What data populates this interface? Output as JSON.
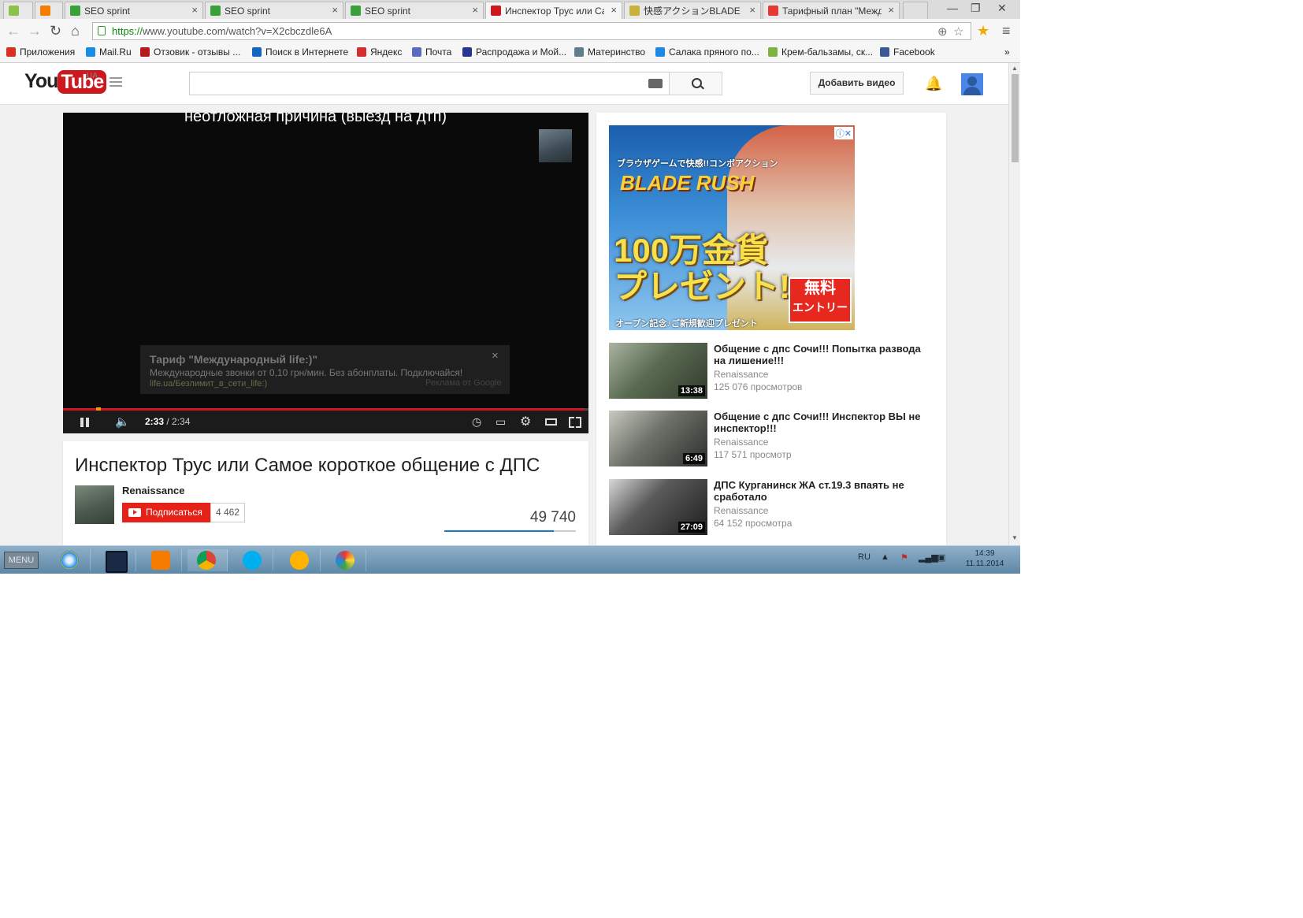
{
  "browser": {
    "tabs": [
      {
        "label": "",
        "fav": "#8bc34a"
      },
      {
        "label": "",
        "fav": "#f57d00"
      },
      {
        "label": "SEO sprint",
        "fav": "#3aa13a"
      },
      {
        "label": "SEO sprint",
        "fav": "#3aa13a"
      },
      {
        "label": "SEO sprint",
        "fav": "#3aa13a"
      },
      {
        "label": "Инспектор Трус или Сам",
        "fav": "#cc181e"
      },
      {
        "label": "快感アクションBLADE RU",
        "fav": "#c9b23c"
      },
      {
        "label": "Тарифный план \"Междун",
        "fav": "#e53935"
      }
    ],
    "close_glyph": "×",
    "window": {
      "minimize": "—",
      "restore": "❐",
      "close": "✕"
    },
    "url_scheme": "https://",
    "url_rest": "www.youtube.com/watch?v=X2cbczdle6A",
    "bookmarks": [
      {
        "label": "Приложения",
        "icon": "#d93025"
      },
      {
        "label": "Mail.Ru",
        "icon": "#168de2"
      },
      {
        "label": "Отзовик - отзывы ...",
        "icon": "#b71c1c"
      },
      {
        "label": "Поиск в Интернете",
        "icon": "#1565c0"
      },
      {
        "label": "Яндекс",
        "icon": "#d32f2f"
      },
      {
        "label": "Почта",
        "icon": "#5c6bc0"
      },
      {
        "label": "Распродажа и Мой...",
        "icon": "#283593"
      },
      {
        "label": "Материнство",
        "icon": "#607d8b"
      },
      {
        "label": "Салака пряного по...",
        "icon": "#1e88e5"
      },
      {
        "label": "Крем-бальзамы, ск...",
        "icon": "#7cb342"
      },
      {
        "label": "Facebook",
        "icon": "#3b5998"
      }
    ],
    "bookmarks_more": "»"
  },
  "youtube": {
    "logo_you": "You",
    "logo_tube": "Tube",
    "region": "UA",
    "upload_label": "Добавить видео",
    "player": {
      "subtitle": "неотложная причина (выезд на дтп)",
      "ad_title": "Тариф \"Международный life:)\"",
      "ad_desc": "Международные звонки от 0,10 грн/мин. Без абонплаты. Подключайся!",
      "ad_url": "life.ua/Безлимит_в_сети_life:)",
      "ad_by": "Реклама от Google",
      "ad_close": "×",
      "time_current": "2:33",
      "time_total": " / 2:34",
      "played_fraction": 0.993
    },
    "video": {
      "title": "Инспектор Трус или Самое короткое общение с ДПС",
      "channel": "Renaissance",
      "subscribe_label": "Подписаться",
      "subscriber_count": "4 462",
      "views": "49 740",
      "like_ratio": 0.83
    },
    "sidebar_ad": {
      "tagline": "ブラウザゲームで快感!!コンボアクション",
      "brand": "BLADE RUSH",
      "headline_1": "100万金貨",
      "headline_2": "プレゼント!",
      "free_1": "無料",
      "free_2": "エントリー",
      "footer": "オープン記念♪ご新規歓迎プレゼント",
      "ad_choice": "ⓘ✕"
    },
    "related": [
      {
        "title": "Общение с дпс Сочи!!! Попытка развода на лишение!!!",
        "channel": "Renaissance",
        "views": "125 076 просмотров",
        "duration": "13:38"
      },
      {
        "title": "Общение с дпс Сочи!!! Инспектор ВЫ не инспектор!!!",
        "channel": "Renaissance",
        "views": "117 571 просмотр",
        "duration": "6:49"
      },
      {
        "title": "ДПС Курганинск ЖА ст.19.3 впаять не сработало",
        "channel": "Renaissance",
        "views": "64 152 просмотра",
        "duration": "27:09"
      }
    ]
  },
  "taskbar": {
    "menu_label": "MENU",
    "lang": "RU",
    "time": "14:39",
    "date": "11.11.2014"
  }
}
